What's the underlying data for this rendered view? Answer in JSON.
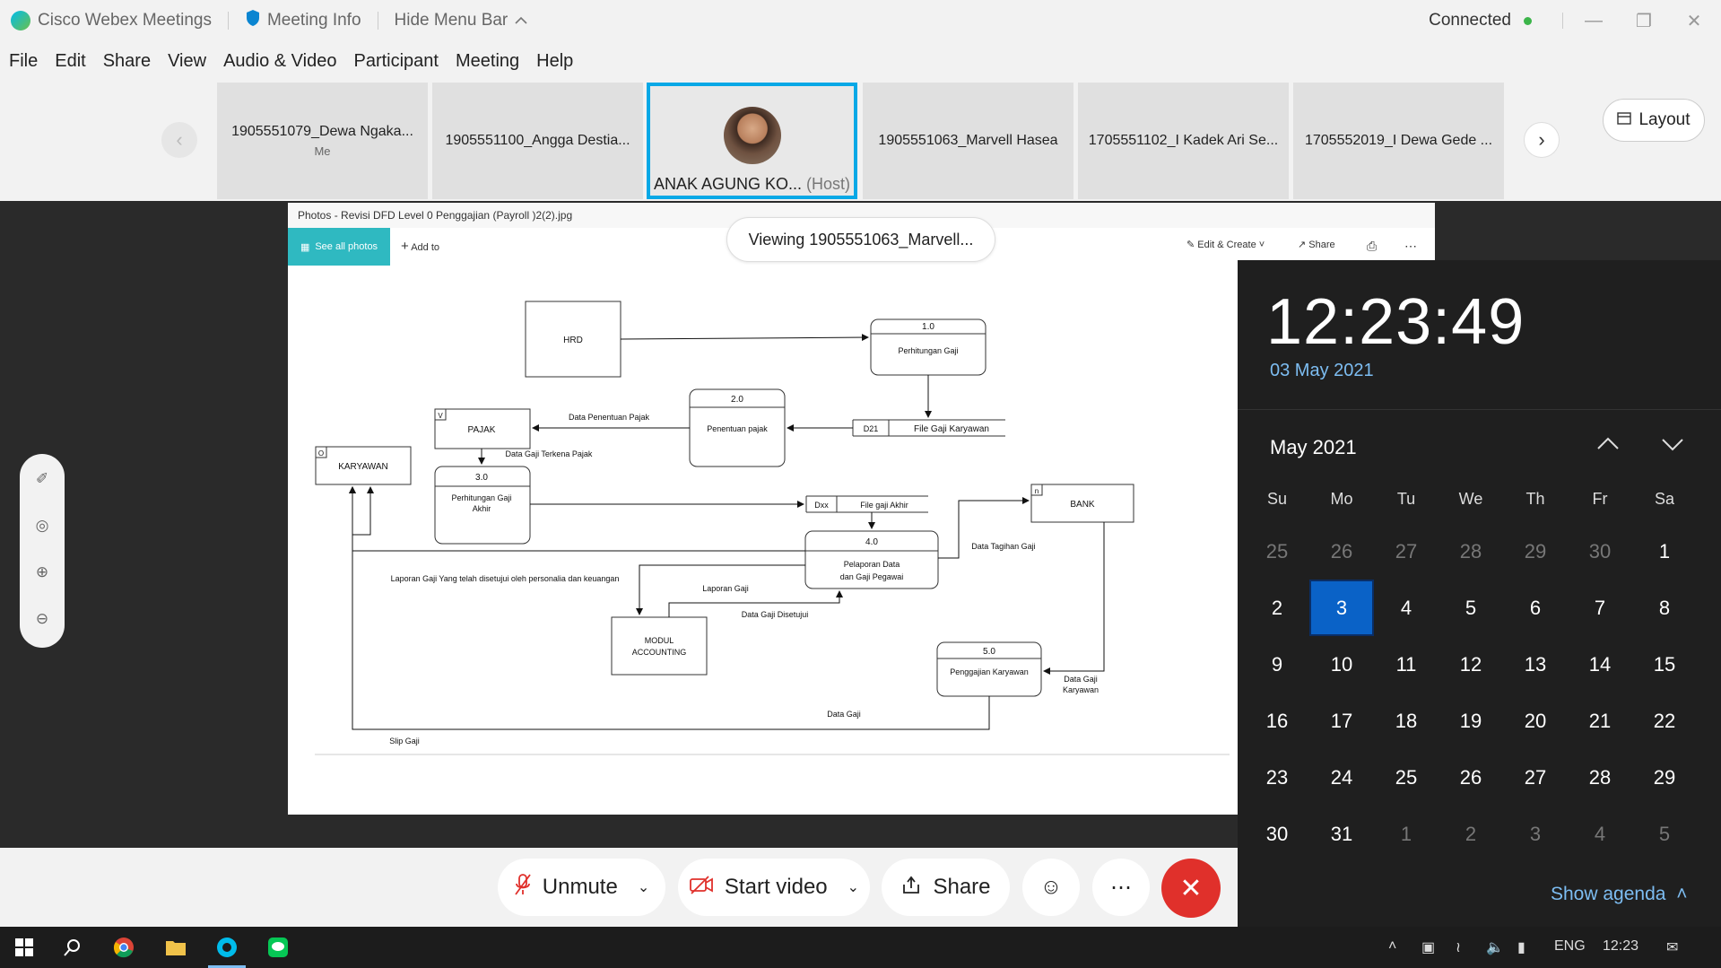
{
  "titlebar": {
    "app_name": "Cisco Webex Meetings",
    "meeting_info": "Meeting Info",
    "hide_menu_bar": "Hide Menu Bar",
    "status": "Connected",
    "status_color": "#3cb54a"
  },
  "menu": [
    "File",
    "Edit",
    "Share",
    "View",
    "Audio & Video",
    "Participant",
    "Meeting",
    "Help"
  ],
  "participants": [
    {
      "name": "1905551079_Dewa Ngaka...",
      "sub": "Me"
    },
    {
      "name": "1905551100_Angga Destia...",
      "sub": ""
    },
    {
      "name": "ANAK AGUNG KO...",
      "sub": "(Host)"
    },
    {
      "name": "1905551063_Marvell Hasea",
      "sub": ""
    },
    {
      "name": "1705551102_I Kadek Ari Se...",
      "sub": ""
    },
    {
      "name": "1705552019_I Dewa Gede ...",
      "sub": ""
    }
  ],
  "layout_label": "Layout",
  "viewing_label": "Viewing 1905551063_Marvell...",
  "photos": {
    "title": "Photos - Revisi DFD Level 0 Penggajian (Payroll )2(2).jpg",
    "see_all": "See all photos",
    "add_to": "Add to",
    "edit_create": "Edit & Create",
    "share": "Share"
  },
  "dfd": {
    "hrd": "HRD",
    "p1_num": "1.0",
    "p1_name": "Perhitungan Gaji",
    "p2_num": "2.0",
    "p2_name": "Penentuan pajak",
    "pajak_tag": "V",
    "pajak": "PAJAK",
    "karyawan_tag": "O",
    "karyawan": "KARYAWAN",
    "p3_num": "3.0",
    "p3_name1": "Perhitungan Gaji",
    "p3_name2": "Akhir",
    "ds_d21_id": "D21",
    "ds_d21": "File Gaji Karyawan",
    "ds_dxx_id": "Dxx",
    "ds_dxx": "File gaji Akhir",
    "p4_num": "4.0",
    "p4_name1": "Pelaporan Data",
    "p4_name2": "dan Gaji Pegawai",
    "bank_tag": "n",
    "bank": "BANK",
    "modul1": "MODUL",
    "modul2": "ACCOUNTING",
    "p5_num": "5.0",
    "p5_name": "Penggajian Karyawan",
    "lbl_penentuan": "Data Penentuan Pajak",
    "lbl_terkena": "Data Gaji Terkena Pajak",
    "lbl_tagihan": "Data Tagihan Gaji",
    "lbl_laporan_long": "Laporan Gaji Yang telah disetujui oleh personalia dan keuangan",
    "lbl_laporan": "Laporan Gaji",
    "lbl_disetujui": "Data Gaji Disetujui",
    "lbl_datagaji_kary1": "Data Gaji",
    "lbl_datagaji_kary2": "Karyawan",
    "lbl_datagaji": "Data Gaji",
    "lbl_slip": "Slip Gaji"
  },
  "controls": {
    "unmute": "Unmute",
    "start_video": "Start video",
    "share": "Share"
  },
  "clock": {
    "time": "12:23:49",
    "date": "03 May 2021",
    "month": "May 2021",
    "dow": [
      "Su",
      "Mo",
      "Tu",
      "We",
      "Th",
      "Fr",
      "Sa"
    ],
    "weeks": [
      [
        "25",
        "26",
        "27",
        "28",
        "29",
        "30",
        "1"
      ],
      [
        "2",
        "3",
        "4",
        "5",
        "6",
        "7",
        "8"
      ],
      [
        "9",
        "10",
        "11",
        "12",
        "13",
        "14",
        "15"
      ],
      [
        "16",
        "17",
        "18",
        "19",
        "20",
        "21",
        "22"
      ],
      [
        "23",
        "24",
        "25",
        "26",
        "27",
        "28",
        "29"
      ],
      [
        "30",
        "31",
        "1",
        "2",
        "3",
        "4",
        "5"
      ]
    ],
    "dim_first_row_count": 6,
    "dim_last_row_from": 2,
    "today": "3",
    "show_agenda": "Show agenda"
  },
  "taskbar": {
    "lang": "ENG",
    "time": "12:23"
  }
}
